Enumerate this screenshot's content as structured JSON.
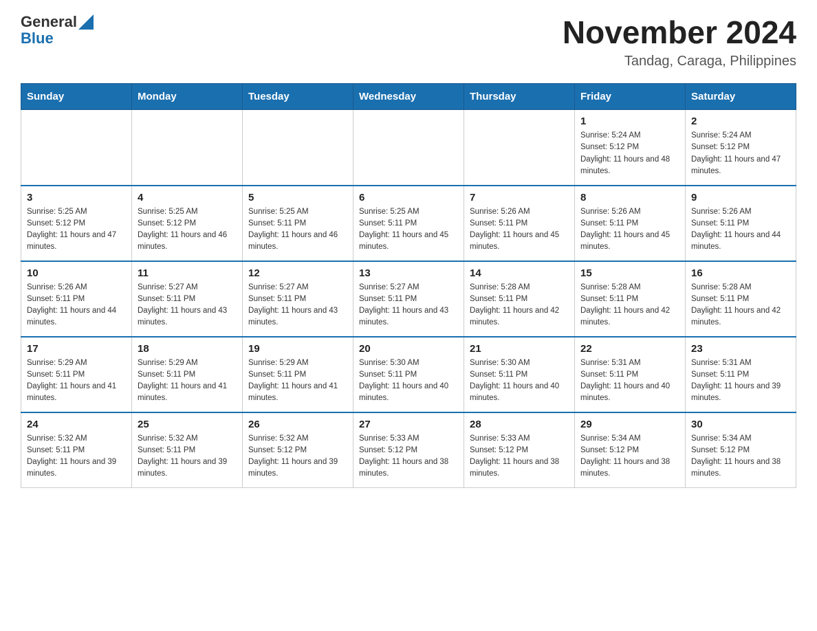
{
  "header": {
    "logo": {
      "general": "General",
      "blue": "Blue"
    },
    "title": "November 2024",
    "location": "Tandag, Caraga, Philippines"
  },
  "weekdays": [
    "Sunday",
    "Monday",
    "Tuesday",
    "Wednesday",
    "Thursday",
    "Friday",
    "Saturday"
  ],
  "weeks": [
    [
      {
        "day": "",
        "sunrise": "",
        "sunset": "",
        "daylight": ""
      },
      {
        "day": "",
        "sunrise": "",
        "sunset": "",
        "daylight": ""
      },
      {
        "day": "",
        "sunrise": "",
        "sunset": "",
        "daylight": ""
      },
      {
        "day": "",
        "sunrise": "",
        "sunset": "",
        "daylight": ""
      },
      {
        "day": "",
        "sunrise": "",
        "sunset": "",
        "daylight": ""
      },
      {
        "day": "1",
        "sunrise": "Sunrise: 5:24 AM",
        "sunset": "Sunset: 5:12 PM",
        "daylight": "Daylight: 11 hours and 48 minutes."
      },
      {
        "day": "2",
        "sunrise": "Sunrise: 5:24 AM",
        "sunset": "Sunset: 5:12 PM",
        "daylight": "Daylight: 11 hours and 47 minutes."
      }
    ],
    [
      {
        "day": "3",
        "sunrise": "Sunrise: 5:25 AM",
        "sunset": "Sunset: 5:12 PM",
        "daylight": "Daylight: 11 hours and 47 minutes."
      },
      {
        "day": "4",
        "sunrise": "Sunrise: 5:25 AM",
        "sunset": "Sunset: 5:12 PM",
        "daylight": "Daylight: 11 hours and 46 minutes."
      },
      {
        "day": "5",
        "sunrise": "Sunrise: 5:25 AM",
        "sunset": "Sunset: 5:11 PM",
        "daylight": "Daylight: 11 hours and 46 minutes."
      },
      {
        "day": "6",
        "sunrise": "Sunrise: 5:25 AM",
        "sunset": "Sunset: 5:11 PM",
        "daylight": "Daylight: 11 hours and 45 minutes."
      },
      {
        "day": "7",
        "sunrise": "Sunrise: 5:26 AM",
        "sunset": "Sunset: 5:11 PM",
        "daylight": "Daylight: 11 hours and 45 minutes."
      },
      {
        "day": "8",
        "sunrise": "Sunrise: 5:26 AM",
        "sunset": "Sunset: 5:11 PM",
        "daylight": "Daylight: 11 hours and 45 minutes."
      },
      {
        "day": "9",
        "sunrise": "Sunrise: 5:26 AM",
        "sunset": "Sunset: 5:11 PM",
        "daylight": "Daylight: 11 hours and 44 minutes."
      }
    ],
    [
      {
        "day": "10",
        "sunrise": "Sunrise: 5:26 AM",
        "sunset": "Sunset: 5:11 PM",
        "daylight": "Daylight: 11 hours and 44 minutes."
      },
      {
        "day": "11",
        "sunrise": "Sunrise: 5:27 AM",
        "sunset": "Sunset: 5:11 PM",
        "daylight": "Daylight: 11 hours and 43 minutes."
      },
      {
        "day": "12",
        "sunrise": "Sunrise: 5:27 AM",
        "sunset": "Sunset: 5:11 PM",
        "daylight": "Daylight: 11 hours and 43 minutes."
      },
      {
        "day": "13",
        "sunrise": "Sunrise: 5:27 AM",
        "sunset": "Sunset: 5:11 PM",
        "daylight": "Daylight: 11 hours and 43 minutes."
      },
      {
        "day": "14",
        "sunrise": "Sunrise: 5:28 AM",
        "sunset": "Sunset: 5:11 PM",
        "daylight": "Daylight: 11 hours and 42 minutes."
      },
      {
        "day": "15",
        "sunrise": "Sunrise: 5:28 AM",
        "sunset": "Sunset: 5:11 PM",
        "daylight": "Daylight: 11 hours and 42 minutes."
      },
      {
        "day": "16",
        "sunrise": "Sunrise: 5:28 AM",
        "sunset": "Sunset: 5:11 PM",
        "daylight": "Daylight: 11 hours and 42 minutes."
      }
    ],
    [
      {
        "day": "17",
        "sunrise": "Sunrise: 5:29 AM",
        "sunset": "Sunset: 5:11 PM",
        "daylight": "Daylight: 11 hours and 41 minutes."
      },
      {
        "day": "18",
        "sunrise": "Sunrise: 5:29 AM",
        "sunset": "Sunset: 5:11 PM",
        "daylight": "Daylight: 11 hours and 41 minutes."
      },
      {
        "day": "19",
        "sunrise": "Sunrise: 5:29 AM",
        "sunset": "Sunset: 5:11 PM",
        "daylight": "Daylight: 11 hours and 41 minutes."
      },
      {
        "day": "20",
        "sunrise": "Sunrise: 5:30 AM",
        "sunset": "Sunset: 5:11 PM",
        "daylight": "Daylight: 11 hours and 40 minutes."
      },
      {
        "day": "21",
        "sunrise": "Sunrise: 5:30 AM",
        "sunset": "Sunset: 5:11 PM",
        "daylight": "Daylight: 11 hours and 40 minutes."
      },
      {
        "day": "22",
        "sunrise": "Sunrise: 5:31 AM",
        "sunset": "Sunset: 5:11 PM",
        "daylight": "Daylight: 11 hours and 40 minutes."
      },
      {
        "day": "23",
        "sunrise": "Sunrise: 5:31 AM",
        "sunset": "Sunset: 5:11 PM",
        "daylight": "Daylight: 11 hours and 39 minutes."
      }
    ],
    [
      {
        "day": "24",
        "sunrise": "Sunrise: 5:32 AM",
        "sunset": "Sunset: 5:11 PM",
        "daylight": "Daylight: 11 hours and 39 minutes."
      },
      {
        "day": "25",
        "sunrise": "Sunrise: 5:32 AM",
        "sunset": "Sunset: 5:11 PM",
        "daylight": "Daylight: 11 hours and 39 minutes."
      },
      {
        "day": "26",
        "sunrise": "Sunrise: 5:32 AM",
        "sunset": "Sunset: 5:12 PM",
        "daylight": "Daylight: 11 hours and 39 minutes."
      },
      {
        "day": "27",
        "sunrise": "Sunrise: 5:33 AM",
        "sunset": "Sunset: 5:12 PM",
        "daylight": "Daylight: 11 hours and 38 minutes."
      },
      {
        "day": "28",
        "sunrise": "Sunrise: 5:33 AM",
        "sunset": "Sunset: 5:12 PM",
        "daylight": "Daylight: 11 hours and 38 minutes."
      },
      {
        "day": "29",
        "sunrise": "Sunrise: 5:34 AM",
        "sunset": "Sunset: 5:12 PM",
        "daylight": "Daylight: 11 hours and 38 minutes."
      },
      {
        "day": "30",
        "sunrise": "Sunrise: 5:34 AM",
        "sunset": "Sunset: 5:12 PM",
        "daylight": "Daylight: 11 hours and 38 minutes."
      }
    ]
  ]
}
